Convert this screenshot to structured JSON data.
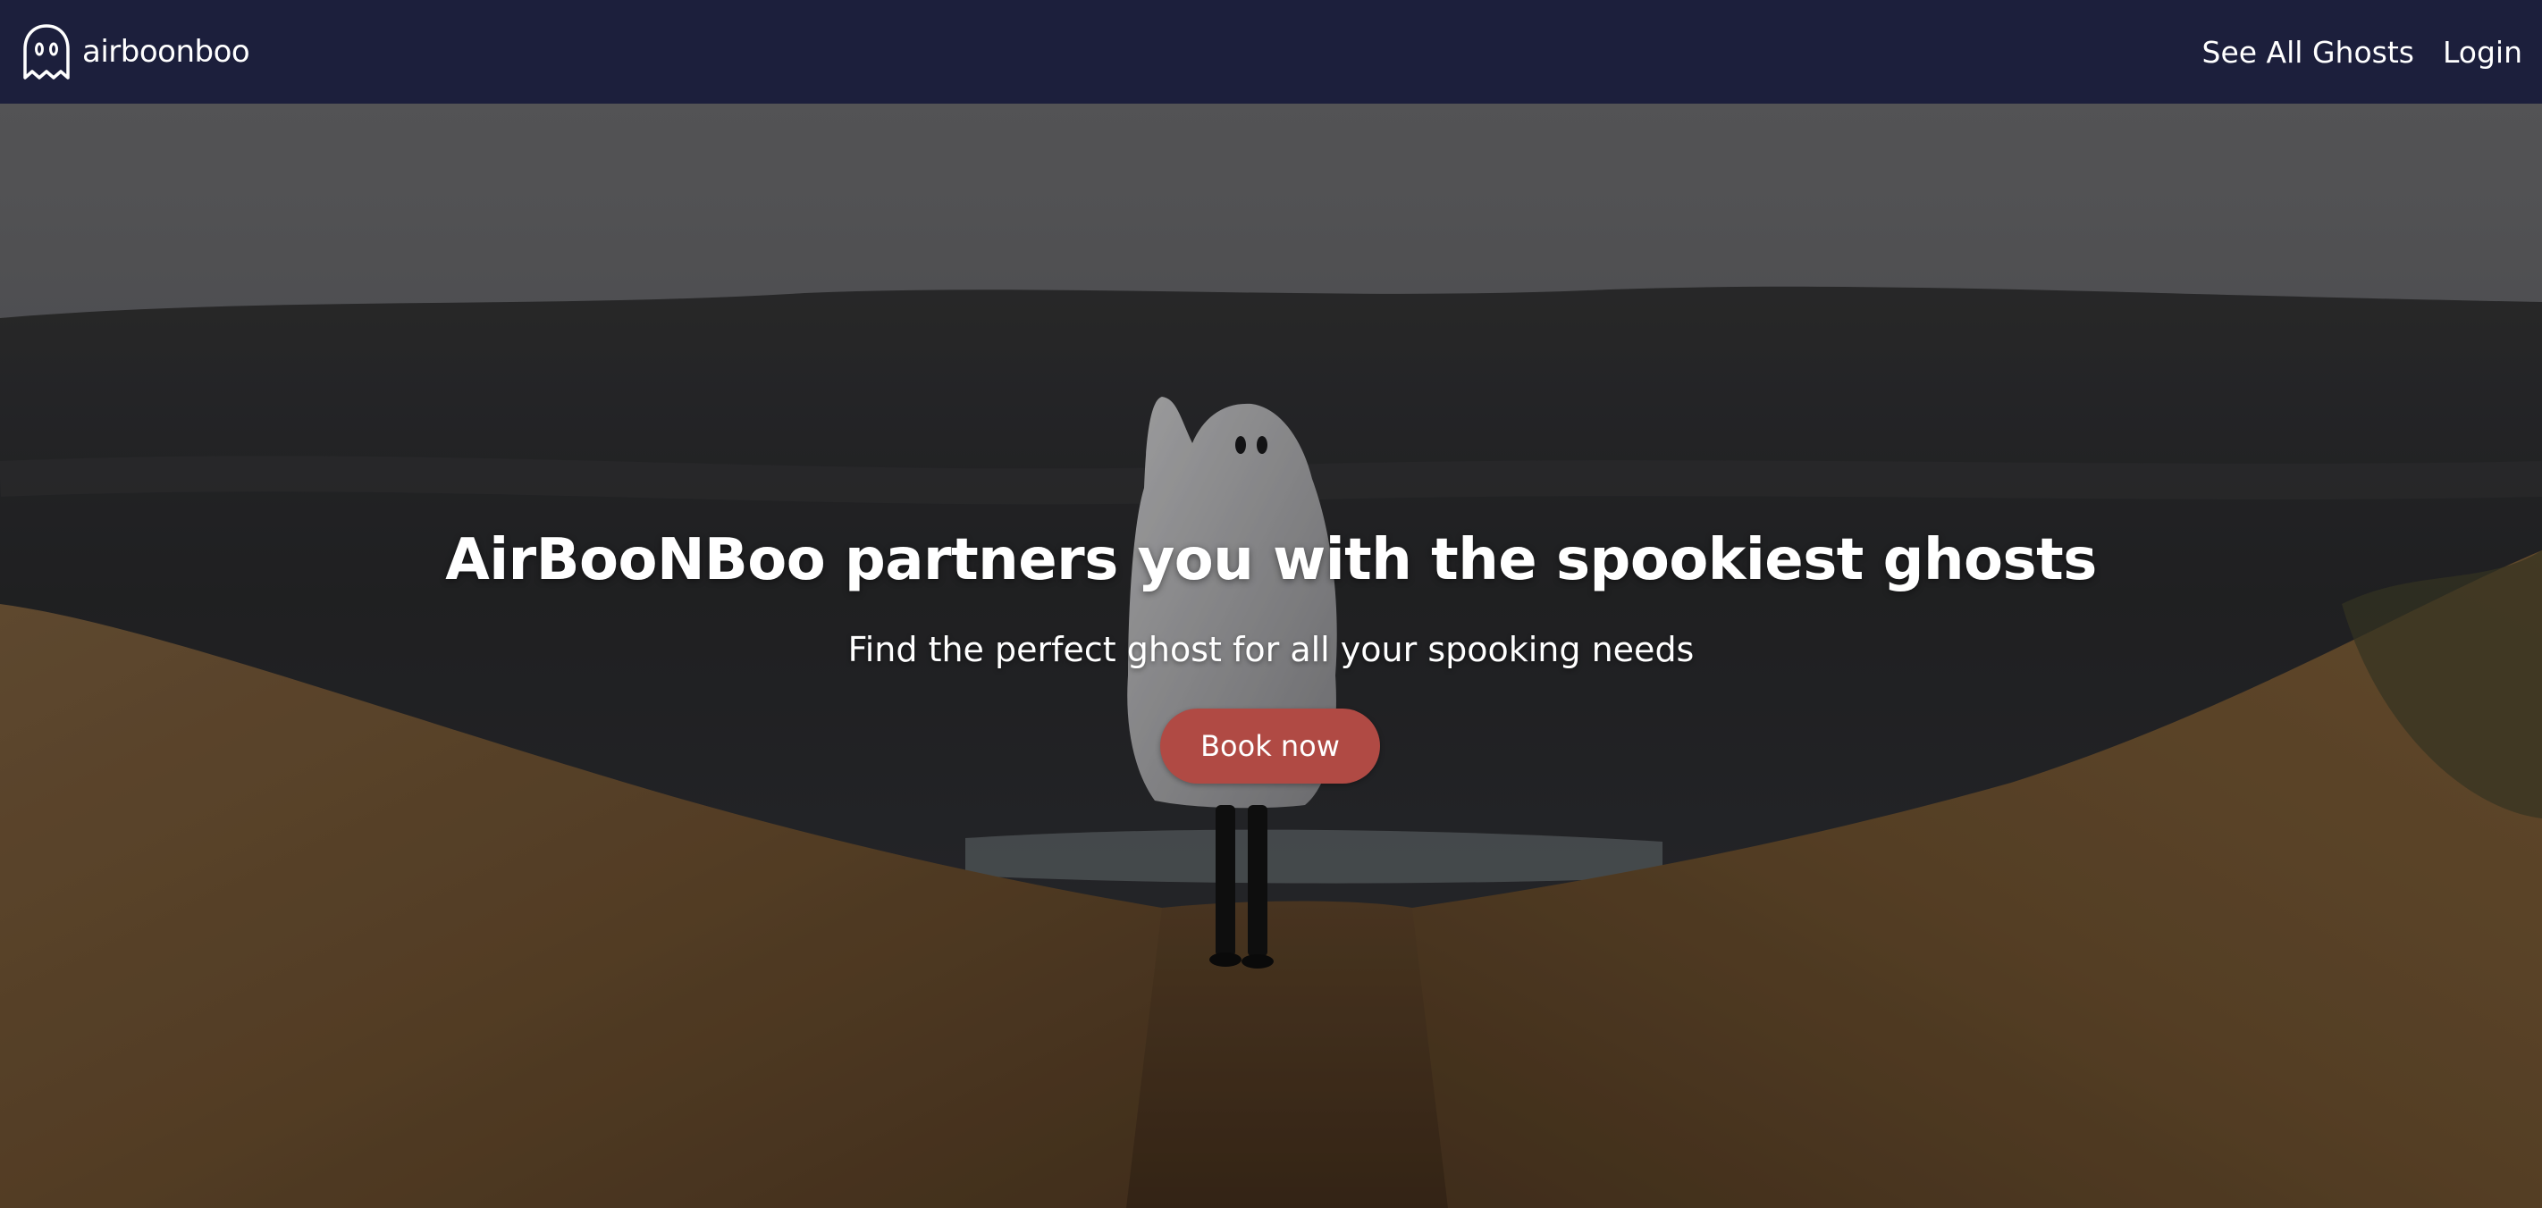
{
  "app": {
    "brand_name": "airboonboo",
    "logo_icon": "ghost-icon"
  },
  "nav": {
    "items": [
      {
        "label": "See All Ghosts"
      },
      {
        "label": "Login"
      }
    ]
  },
  "hero": {
    "title": "AirBooNBoo partners you with the spookiest ghosts",
    "subtitle": "Find the perfect ghost for all your spooking needs",
    "cta_label": "Book now"
  },
  "colors": {
    "navbar_bg": "#1c1f3c",
    "cta_bg": "#b04a44",
    "text": "#ffffff"
  }
}
